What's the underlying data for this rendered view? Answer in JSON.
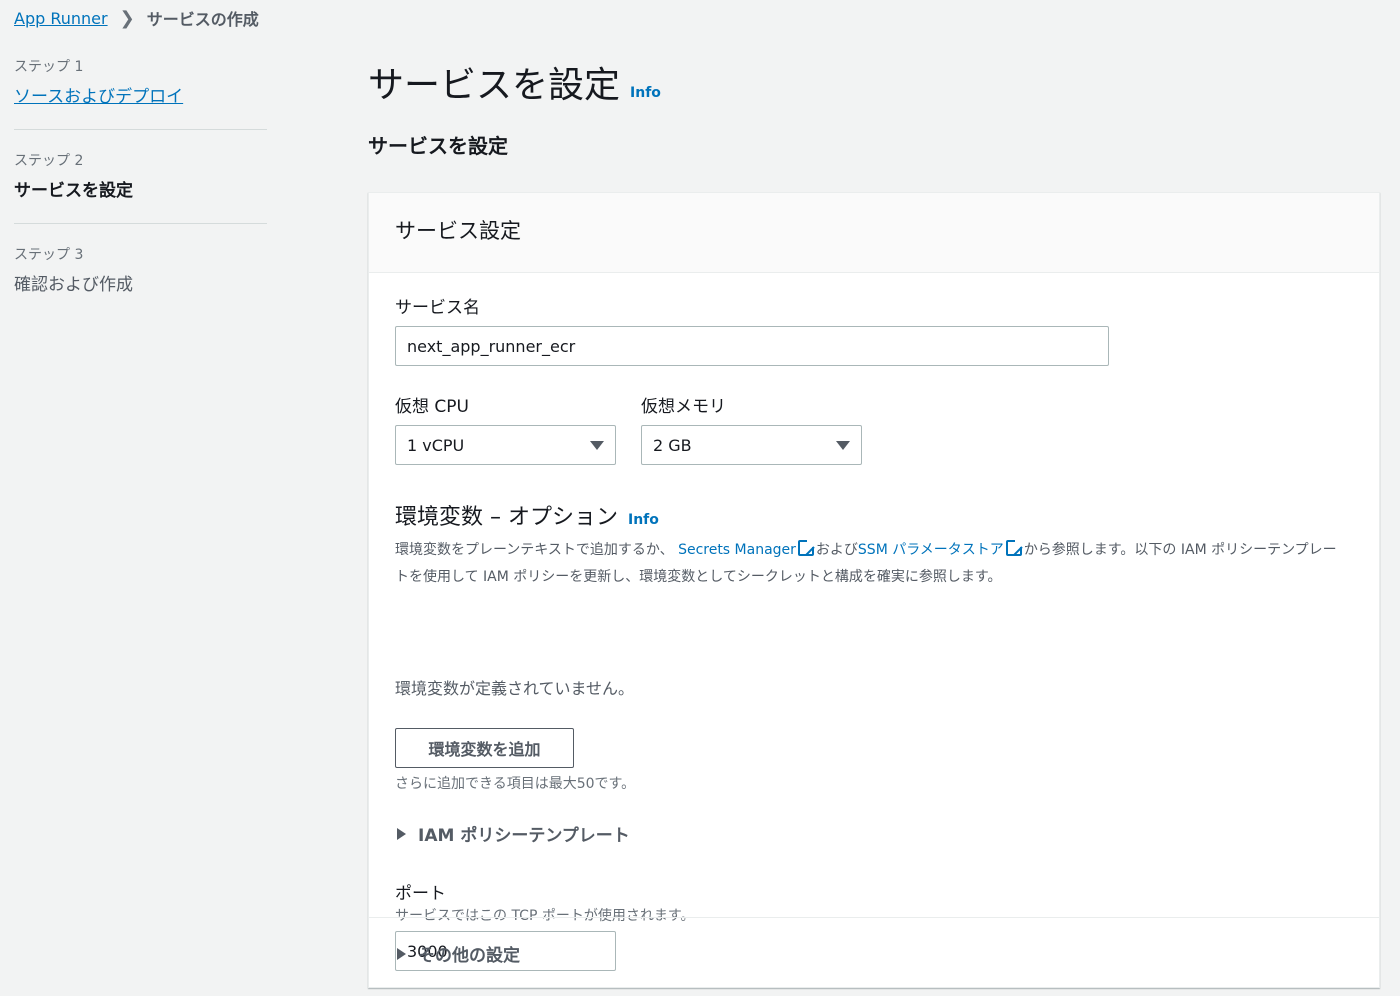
{
  "breadcrumb": {
    "parent": "App Runner",
    "current": "サービスの作成"
  },
  "steps": [
    {
      "label": "ステップ 1",
      "title": "ソースおよびデプロイ"
    },
    {
      "label": "ステップ 2",
      "title": "サービスを設定"
    },
    {
      "label": "ステップ 3",
      "title": "確認および作成"
    }
  ],
  "page": {
    "title": "サービスを設定",
    "info": "Info",
    "section_title": "サービスを設定"
  },
  "panel": {
    "header": "サービス設定",
    "service_name": {
      "label": "サービス名",
      "value": "next_app_runner_ecr"
    },
    "cpu": {
      "label": "仮想 CPU",
      "value": "1 vCPU"
    },
    "memory": {
      "label": "仮想メモリ",
      "value": "2 GB"
    },
    "env": {
      "title": "環境変数 – オプション",
      "info": "Info",
      "desc_part1": "環境変数をプレーンテキストで追加するか、 ",
      "secrets_link": "Secrets Manager",
      "desc_part2": "および",
      "ssm_link": "SSM パラメータストア",
      "desc_part3": "から参照します。以下の IAM ポリシーテンプレートを使用して IAM ポリシーを更新し、環境変数としてシークレットと構成を確実に参照します。",
      "empty_text": "環境変数が定義されていません。",
      "add_button": "環境変数を追加",
      "limit_hint": "さらに追加できる項目は最大50です。",
      "iam_template": "IAM ポリシーテンプレート"
    },
    "port": {
      "label": "ポート",
      "hint": "サービスではこの TCP ポートが使用されます。",
      "value": "3000"
    },
    "other_settings": "その他の設定"
  },
  "colors": {
    "link": "#0073bb",
    "background": "#f2f3f3"
  }
}
